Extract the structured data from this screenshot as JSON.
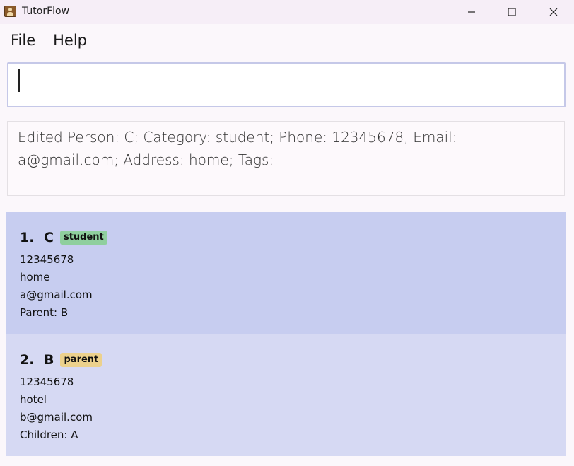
{
  "window": {
    "title": "TutorFlow"
  },
  "menu": {
    "items": [
      "File",
      "Help"
    ]
  },
  "command": {
    "value": "",
    "placeholder": ""
  },
  "result": {
    "text": "Edited Person: C; Category: student; Phone: 12345678; Email: a@gmail.com; Address: home; Tags:"
  },
  "persons": [
    {
      "index": "1.",
      "name": "C",
      "tag": "student",
      "tag_color": "#8fcf9e",
      "phone": "12345678",
      "address": "home",
      "email": "a@gmail.com",
      "relation": "Parent: B"
    },
    {
      "index": "2.",
      "name": "B",
      "tag": "parent",
      "tag_color": "#ecd18c",
      "phone": "12345678",
      "address": "hotel",
      "email": "b@gmail.com",
      "relation": "Children: A"
    }
  ],
  "colors": {
    "card_selected": "#c7cdf0",
    "card_default": "#d6d9f3",
    "command_border": "#c5c8e8"
  }
}
